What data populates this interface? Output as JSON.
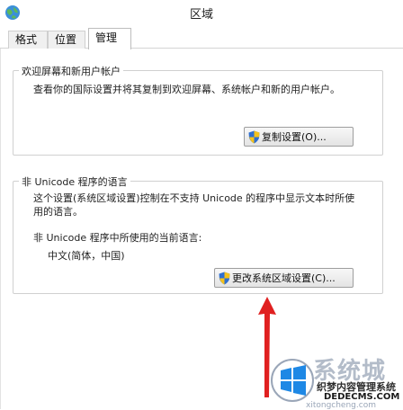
{
  "window": {
    "title": "区域"
  },
  "tabs": [
    {
      "label": "格式"
    },
    {
      "label": "位置"
    },
    {
      "label": "管理"
    }
  ],
  "welcome_group": {
    "legend": "欢迎屏幕和新用户帐户",
    "description": "查看你的国际设置并将其复制到欢迎屏幕、系统帐户和新的用户帐户。",
    "copy_button_label": "复制设置(O)..."
  },
  "unicode_group": {
    "legend": "非 Unicode 程序的语言",
    "description_line1": "这个设置(系统区域设置)控制在不支持 Unicode 的程序中显示文本时所使",
    "description_line2": "用的语言。",
    "current_label": "非 Unicode 程序中所使用的当前语言:",
    "current_value": "中文(简体，中国)",
    "change_button_label": "更改系统区域设置(C)..."
  },
  "watermark": {
    "brand": "系统城",
    "line1": "织梦内容管理系统",
    "line2": "DEDECMS.COM",
    "line3": "xitongcheng.com"
  },
  "colors": {
    "arrow": "#e02020",
    "shield_blue": "#2f6fd0",
    "shield_yellow": "#f4c21c"
  }
}
